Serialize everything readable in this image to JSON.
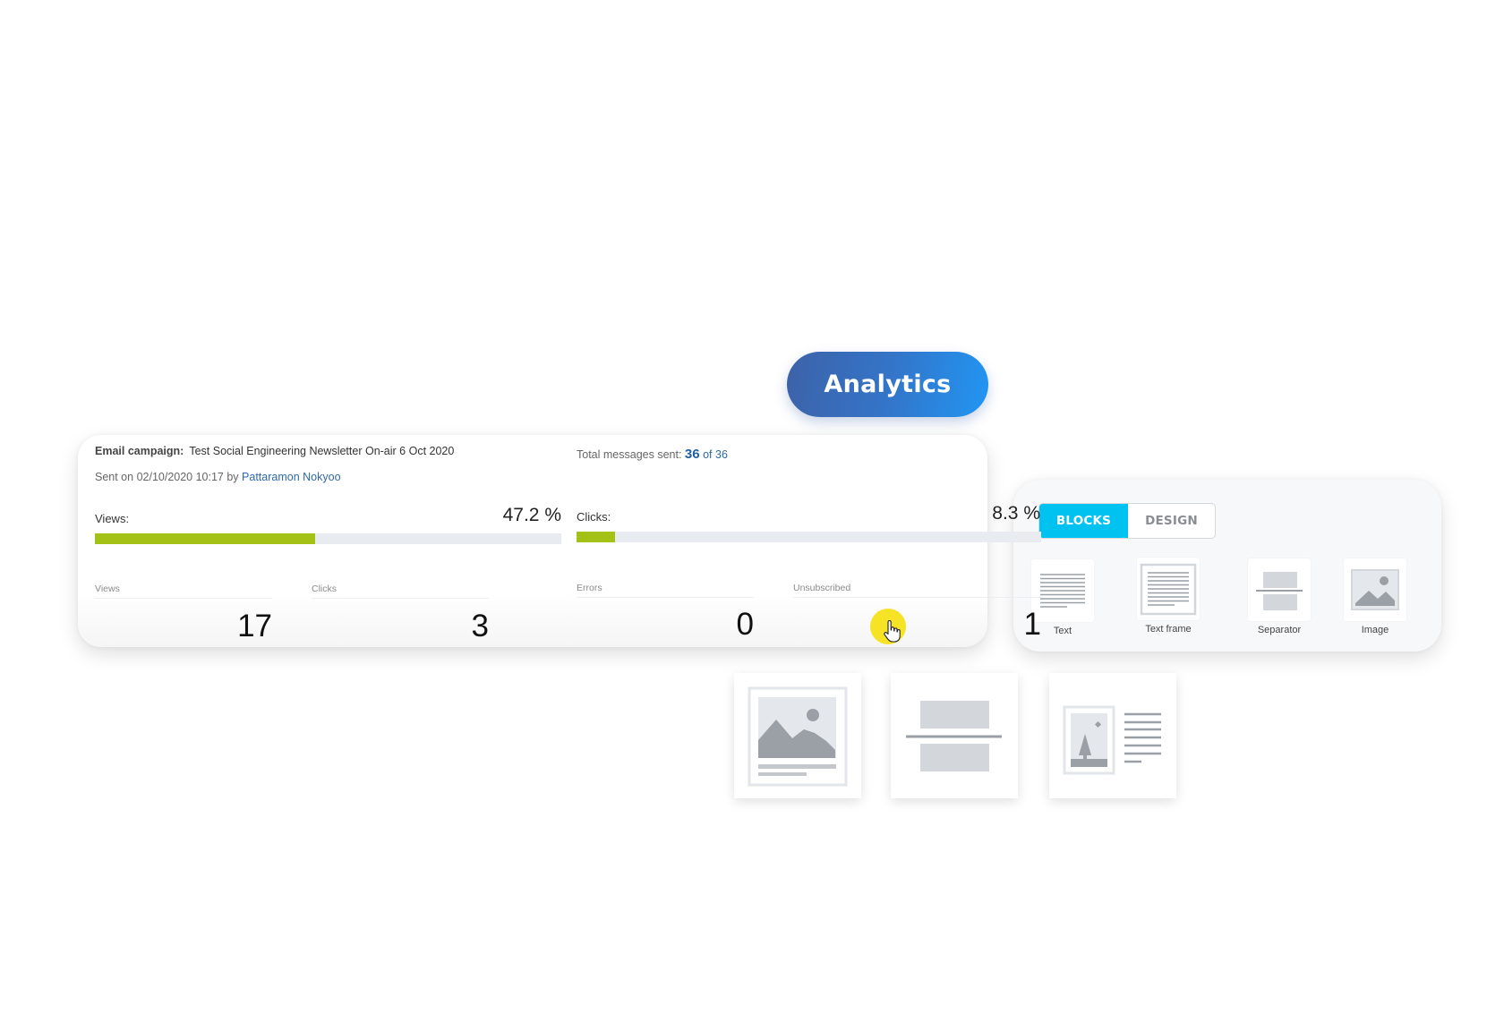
{
  "badge": {
    "label": "Analytics",
    "gradient": [
      "#3d62a8",
      "#2196f3"
    ]
  },
  "campaign": {
    "label": "Email campaign:",
    "name": "Test Social Engineering Newsletter On-air 6 Oct 2020",
    "sent_prefix": "Sent on 02/10/2020 10:17 by",
    "sender": "Pattaramon Nokyoo",
    "total_label": "Total messages sent:",
    "total_sent": "36",
    "total_of": "of",
    "total_count": "36"
  },
  "metrics": {
    "views": {
      "label": "Views:",
      "percent_text": "47.2 %",
      "percent": 47.2
    },
    "clicks": {
      "label": "Clicks:",
      "percent_text": "8.3 %",
      "percent": 8.3
    },
    "bar_color": "#a4c117",
    "bar_track": "#e8ebf0"
  },
  "stats": [
    {
      "label": "Views",
      "value": "17"
    },
    {
      "label": "Clicks",
      "value": "3"
    },
    {
      "label": "Errors",
      "value": "0"
    },
    {
      "label": "Unsubscribed",
      "value": "1"
    }
  ],
  "editor": {
    "tabs": [
      {
        "label": "BLOCKS",
        "active": true
      },
      {
        "label": "DESIGN",
        "active": false
      }
    ],
    "accent": "#00c2f0",
    "blocks": [
      {
        "label": "Text",
        "icon": "text-block-icon"
      },
      {
        "label": "Text frame",
        "icon": "text-frame-block-icon"
      },
      {
        "label": "Separator",
        "icon": "separator-block-icon"
      },
      {
        "label": "Image",
        "icon": "image-block-icon"
      }
    ]
  },
  "floating_tiles": [
    {
      "icon": "image-caption-block-icon"
    },
    {
      "icon": "separator-block-icon"
    },
    {
      "icon": "image-text-block-icon"
    }
  ]
}
